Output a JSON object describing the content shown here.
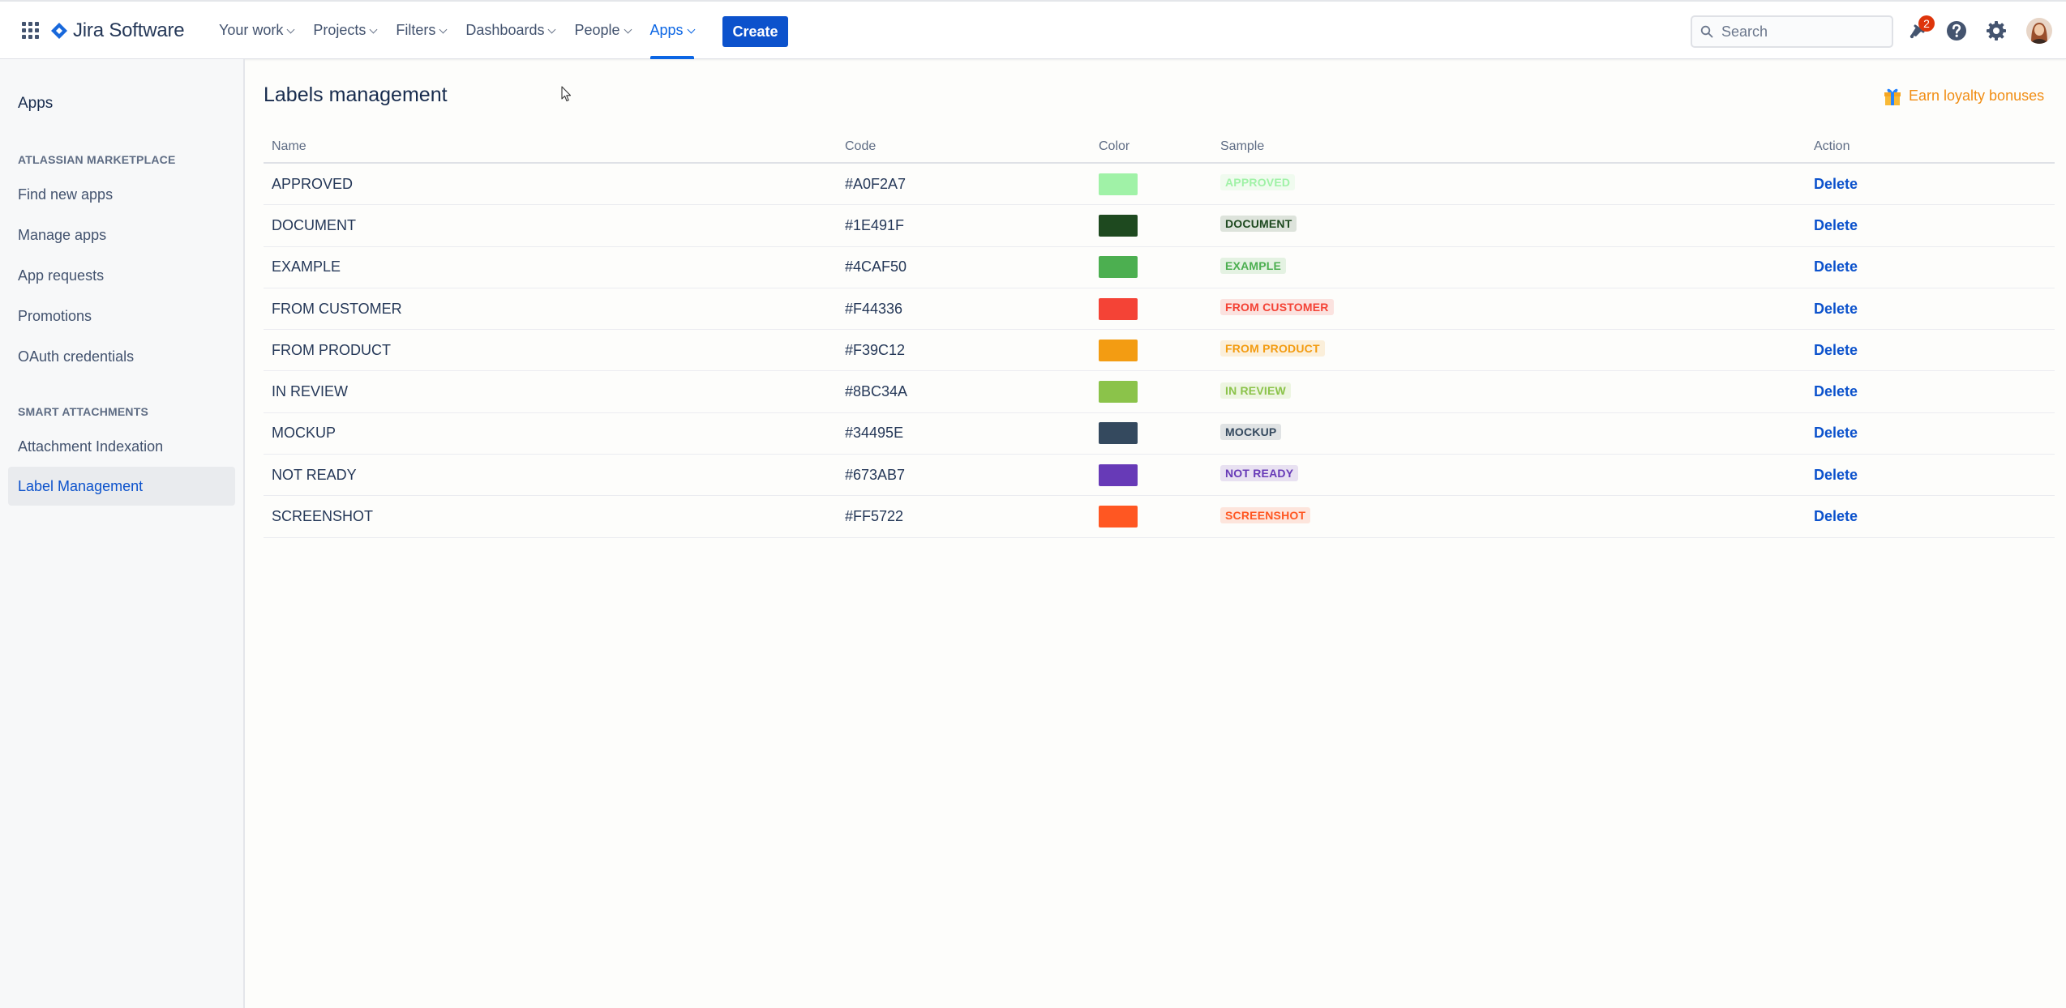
{
  "nav": {
    "app_name": "Jira Software",
    "items": [
      {
        "label": "Your work"
      },
      {
        "label": "Projects"
      },
      {
        "label": "Filters"
      },
      {
        "label": "Dashboards"
      },
      {
        "label": "People"
      },
      {
        "label": "Apps",
        "active": true
      }
    ],
    "create_label": "Create",
    "search_placeholder": "Search",
    "notification_count": "2",
    "brand_color": "#0c52cc",
    "icons": [
      "app-switcher-icon",
      "jira-logo-icon",
      "search-icon",
      "notification-icon",
      "help-icon",
      "settings-icon"
    ]
  },
  "sidebar": {
    "title": "Apps",
    "sections": [
      {
        "heading": "ATLASSIAN MARKETPLACE",
        "items": [
          {
            "label": "Find new apps"
          },
          {
            "label": "Manage apps"
          },
          {
            "label": "App requests"
          },
          {
            "label": "Promotions"
          },
          {
            "label": "OAuth credentials"
          }
        ]
      },
      {
        "heading": "SMART ATTACHMENTS",
        "items": [
          {
            "label": "Attachment Indexation"
          },
          {
            "label": "Label Management",
            "selected": true
          }
        ]
      }
    ]
  },
  "main": {
    "title": "Labels management",
    "loyalty_link": "Earn loyalty bonuses",
    "columns": {
      "name": "Name",
      "code": "Code",
      "color": "Color",
      "sample": "Sample",
      "action": "Action"
    },
    "labels": [
      {
        "name": "APPROVED",
        "code": "#A0F2A7",
        "color": "#A0F2A7",
        "sample": "APPROVED",
        "action": "Delete"
      },
      {
        "name": "DOCUMENT",
        "code": "#1E491F",
        "color": "#1E491F",
        "sample": "DOCUMENT",
        "action": "Delete"
      },
      {
        "name": "EXAMPLE",
        "code": "#4CAF50",
        "color": "#4CAF50",
        "sample": "EXAMPLE",
        "action": "Delete"
      },
      {
        "name": "FROM CUSTOMER",
        "code": "#F44336",
        "color": "#F44336",
        "sample": "FROM CUSTOMER",
        "action": "Delete"
      },
      {
        "name": "FROM PRODUCT",
        "code": "#F39C12",
        "color": "#F39C12",
        "sample": "FROM PRODUCT",
        "action": "Delete"
      },
      {
        "name": "IN REVIEW",
        "code": "#8BC34A",
        "color": "#8BC34A",
        "sample": "IN REVIEW",
        "action": "Delete"
      },
      {
        "name": "MOCKUP",
        "code": "#34495E",
        "color": "#34495E",
        "sample": "MOCKUP",
        "action": "Delete"
      },
      {
        "name": "NOT READY",
        "code": "#673AB7",
        "color": "#673AB7",
        "sample": "NOT READY",
        "action": "Delete"
      },
      {
        "name": "SCREENSHOT",
        "code": "#FF5722",
        "color": "#FF5722",
        "sample": "SCREENSHOT",
        "action": "Delete"
      }
    ]
  }
}
